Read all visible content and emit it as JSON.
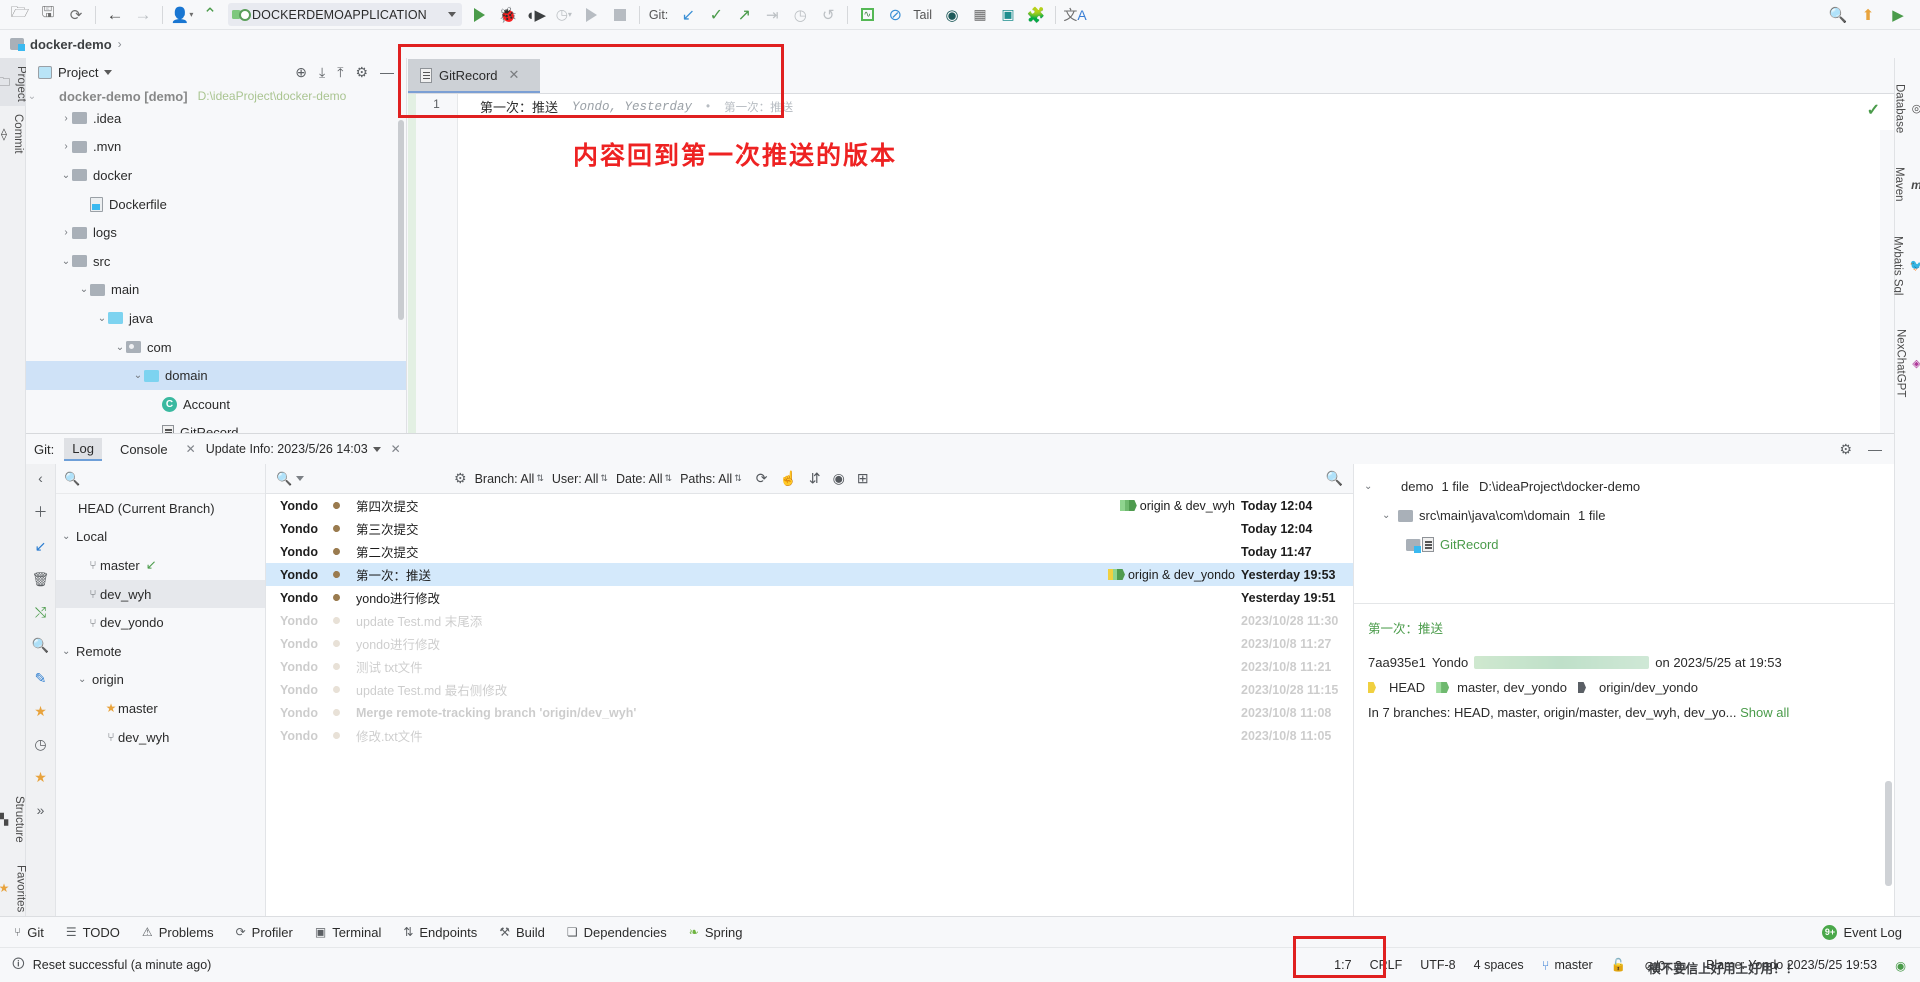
{
  "toolbar": {
    "icons": [
      "open-folder",
      "save-all",
      "sync",
      "back",
      "forward",
      "profile",
      "build"
    ],
    "run_config": "DOCKERDEMOAPPLICATION",
    "git_label": "Git:",
    "tail_label": "Tail"
  },
  "breadcrumb": {
    "project": "docker-demo",
    "separator": "›"
  },
  "rail_left": {
    "items": [
      {
        "label": "Project",
        "icon": "project-icon"
      },
      {
        "label": "Commit",
        "icon": "commit-icon"
      },
      {
        "label": "Structure",
        "icon": "structure-icon"
      },
      {
        "label": "Favorites",
        "icon": "star-icon"
      }
    ]
  },
  "rail_right": {
    "items": [
      {
        "label": "Database",
        "icon": "database-icon"
      },
      {
        "label": "Maven",
        "icon": "maven-icon"
      },
      {
        "label": "Mybatis Sql",
        "icon": "mybatis-icon"
      },
      {
        "label": "NexChatGPT",
        "icon": "nexchatgpt-icon"
      }
    ]
  },
  "project": {
    "title": "Project",
    "root": "docker-demo [demo]",
    "root_path": "D:\\ideaProject\\docker-demo",
    "tree": [
      {
        "label": ".idea",
        "depth": 1,
        "arrow": "›",
        "icon": "folder",
        "sel": false
      },
      {
        "label": ".mvn",
        "depth": 1,
        "arrow": "›",
        "icon": "folder",
        "sel": false
      },
      {
        "label": "docker",
        "depth": 1,
        "arrow": "⌄",
        "icon": "folder",
        "sel": false
      },
      {
        "label": "Dockerfile",
        "depth": 2,
        "arrow": "",
        "icon": "dockerfile",
        "sel": false
      },
      {
        "label": "logs",
        "depth": 1,
        "arrow": "›",
        "icon": "folder",
        "sel": false
      },
      {
        "label": "src",
        "depth": 1,
        "arrow": "⌄",
        "icon": "folder",
        "sel": false
      },
      {
        "label": "main",
        "depth": 2,
        "arrow": "⌄",
        "icon": "folder",
        "sel": false
      },
      {
        "label": "java",
        "depth": 3,
        "arrow": "⌄",
        "icon": "folder-blue",
        "sel": false
      },
      {
        "label": "com",
        "depth": 4,
        "arrow": "⌄",
        "icon": "folder-src",
        "sel": false
      },
      {
        "label": "domain",
        "depth": 5,
        "arrow": "⌄",
        "icon": "folder-blue",
        "sel": true
      },
      {
        "label": "Account",
        "depth": 6,
        "arrow": "",
        "icon": "class",
        "sel": false
      },
      {
        "label": "GitRecord",
        "depth": 6,
        "arrow": "",
        "icon": "gitfile",
        "sel": false
      }
    ]
  },
  "editor": {
    "tab": {
      "name": "GitRecord",
      "close": "✕"
    },
    "line_number": "1",
    "line_text": "第一次：推送",
    "blame": "Yondo, Yesterday",
    "blame_sep": "•",
    "blame_msg": "第一次：推送",
    "annotation": "内容回到第一次推送的版本",
    "inspection_ok": "✓"
  },
  "git": {
    "label": "Git:",
    "tabs": [
      {
        "label": "Log",
        "selected": true
      },
      {
        "label": "Console",
        "selected": false
      }
    ],
    "console_close": "✕",
    "update_info": "Update Info: 2023/5/26 14:03",
    "update_close": "✕",
    "branches_title": "",
    "branches": [
      {
        "label": "HEAD (Current Branch)",
        "depth": 0,
        "arrow": "",
        "icon": "",
        "sel": false
      },
      {
        "label": "Local",
        "depth": 0,
        "arrow": "⌄",
        "icon": "",
        "sel": false
      },
      {
        "label": "master",
        "depth": 1,
        "arrow": "",
        "icon": "branch",
        "sel": false,
        "marker": "↙"
      },
      {
        "label": "dev_wyh",
        "depth": 1,
        "arrow": "",
        "icon": "branch",
        "sel": true
      },
      {
        "label": "dev_yondo",
        "depth": 1,
        "arrow": "",
        "icon": "branch",
        "sel": false
      },
      {
        "label": "Remote",
        "depth": 0,
        "arrow": "⌄",
        "icon": "",
        "sel": false
      },
      {
        "label": "origin",
        "depth": 1,
        "arrow": "⌄",
        "icon": "",
        "sel": false
      },
      {
        "label": "master",
        "depth": 2,
        "arrow": "",
        "icon": "star",
        "sel": false
      },
      {
        "label": "dev_wyh",
        "depth": 2,
        "arrow": "",
        "icon": "branch",
        "sel": false
      }
    ],
    "log_toolbar": {
      "search_placeholder": "",
      "filters": [
        "Branch: All",
        "User: All",
        "Date: All",
        "Paths: All"
      ]
    },
    "commits": [
      {
        "author": "Yondo",
        "subject": "第四次提交",
        "refs": "origin & dev_wyh",
        "ref_color": "#7ac77a",
        "date": "Today 12:04",
        "sel": false,
        "faded": false
      },
      {
        "author": "Yondo",
        "subject": "第三次提交",
        "refs": "",
        "ref_color": "",
        "date": "Today 12:04",
        "sel": false,
        "faded": false
      },
      {
        "author": "Yondo",
        "subject": "第二次提交",
        "refs": "",
        "ref_color": "",
        "date": "Today 11:47",
        "sel": false,
        "faded": false
      },
      {
        "author": "Yondo",
        "subject": "第一次：推送",
        "refs": "origin & dev_yondo",
        "ref_color": "#e8c83c",
        "date": "Yesterday 19:53",
        "sel": true,
        "faded": false
      },
      {
        "author": "Yondo",
        "subject": "yondo进行修改",
        "refs": "",
        "ref_color": "",
        "date": "Yesterday 19:51",
        "sel": false,
        "faded": false
      },
      {
        "author": "Yondo",
        "subject": "update Test.md 末尾添",
        "refs": "",
        "ref_color": "",
        "date": "2023/10/28 11:30",
        "sel": false,
        "faded": true
      },
      {
        "author": "Yondo",
        "subject": "yondo进行修改",
        "refs": "",
        "ref_color": "",
        "date": "2023/10/8 11:27",
        "sel": false,
        "faded": true
      },
      {
        "author": "Yondo",
        "subject": "测试 txt文件",
        "refs": "",
        "ref_color": "",
        "date": "2023/10/8 11:21",
        "sel": false,
        "faded": true
      },
      {
        "author": "Yondo",
        "subject": "update Test.md 最右侧修改",
        "refs": "",
        "ref_color": "",
        "date": "2023/10/28 11:15",
        "sel": false,
        "faded": true
      },
      {
        "author": "Yondo",
        "subject": "Merge remote-tracking branch 'origin/dev_wyh'",
        "refs": "",
        "ref_color": "",
        "date": "2023/10/8 11:08",
        "sel": false,
        "faded": true
      },
      {
        "author": "Yondo",
        "subject": "修改.txt文件",
        "refs": "",
        "ref_color": "",
        "date": "2023/10/8 11:05",
        "sel": false,
        "faded": true
      }
    ],
    "details": {
      "tree": [
        {
          "label": "demo",
          "count": "1 file",
          "path": "D:\\ideaProject\\docker-demo",
          "depth": 0,
          "arrow": "⌄",
          "icon": "module"
        },
        {
          "label": "src\\main\\java\\com\\domain",
          "count": "1 file",
          "path": "",
          "depth": 1,
          "arrow": "⌄",
          "icon": "folder"
        },
        {
          "label": "GitRecord",
          "count": "",
          "path": "",
          "depth": 2,
          "arrow": "",
          "icon": "gitfile"
        }
      ],
      "subject": "第一次：推送",
      "hash": "7aa935e1",
      "author": "Yondo",
      "email_redacted": true,
      "date_line": "on 2023/5/25 at 19:53",
      "refs": [
        {
          "label": "HEAD",
          "color": "#e8c83c"
        },
        {
          "label": "master,  dev_yondo",
          "color": "#7ac77a"
        },
        {
          "label": "origin/dev_yondo",
          "color": "#8a8f95"
        }
      ],
      "branches_line": "In 7 branches: HEAD, master, origin/master, dev_wyh, dev_yo...",
      "show_all": "Show all"
    }
  },
  "toolwindows": {
    "items": [
      {
        "label": "Git",
        "icon": "git-icon"
      },
      {
        "label": "TODO",
        "icon": "todo-icon"
      },
      {
        "label": "Problems",
        "icon": "problems-icon"
      },
      {
        "label": "Profiler",
        "icon": "profiler-icon"
      },
      {
        "label": "Terminal",
        "icon": "terminal-icon"
      },
      {
        "label": "Endpoints",
        "icon": "endpoints-icon"
      },
      {
        "label": "Build",
        "icon": "build-icon"
      },
      {
        "label": "Dependencies",
        "icon": "dependencies-icon"
      },
      {
        "label": "Spring",
        "icon": "spring-icon"
      }
    ],
    "event_log": "Event Log",
    "event_badge": "9+"
  },
  "status": {
    "message": "Reset successful (a minute ago)",
    "caret": "1:7",
    "line_sep": "CRLF",
    "encoding": "UTF-8",
    "indent": "4 spaces",
    "branch": "master",
    "lock": "lock-icon",
    "inspection": "⊘/0↑ 3↓",
    "blame": "Blame: Yondo 2023/5/25 19:53",
    "watermark": "横不要信上好用上好用！！"
  },
  "colors": {
    "accent": "#3a7fd5",
    "selection": "#d4e9fb",
    "tree_selection": "#cfe2f7",
    "annotation_red": "#ee2222",
    "green": "#4a9b4a"
  }
}
